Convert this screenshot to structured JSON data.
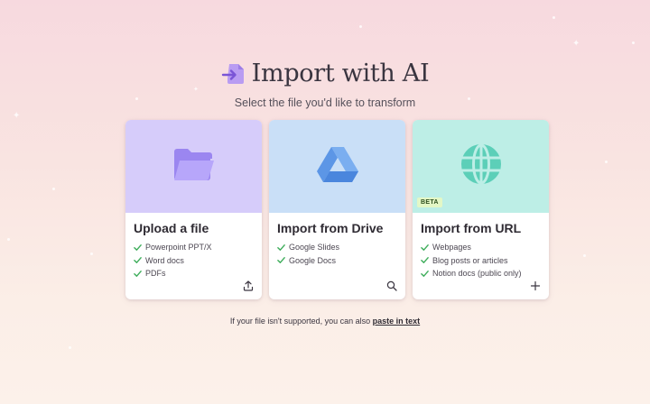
{
  "header": {
    "title": "Import with AI",
    "subtitle": "Select the file you'd like to transform",
    "icon": "import-arrow-icon"
  },
  "cards": [
    {
      "title": "Upload a file",
      "illustration": "folder-icon",
      "color": "#d6ccfa",
      "features": [
        "Powerpoint PPT/X",
        "Word docs",
        "PDFs"
      ],
      "action_icon": "upload-icon"
    },
    {
      "title": "Import from Drive",
      "illustration": "google-drive-icon",
      "color": "#c9dff7",
      "features": [
        "Google Slides",
        "Google Docs"
      ],
      "action_icon": "search-icon"
    },
    {
      "title": "Import from URL",
      "illustration": "globe-icon",
      "color": "#bdeee6",
      "badge": "BETA",
      "features": [
        "Webpages",
        "Blog posts or articles",
        "Notion docs (public only)"
      ],
      "action_icon": "plus-icon"
    }
  ],
  "footer": {
    "text": "If your file isn't supported, you can also",
    "link": "paste in text"
  },
  "colors": {
    "accent": "#a98df0",
    "check": "#3fae5c",
    "badge_bg": "#e3f7c6"
  }
}
